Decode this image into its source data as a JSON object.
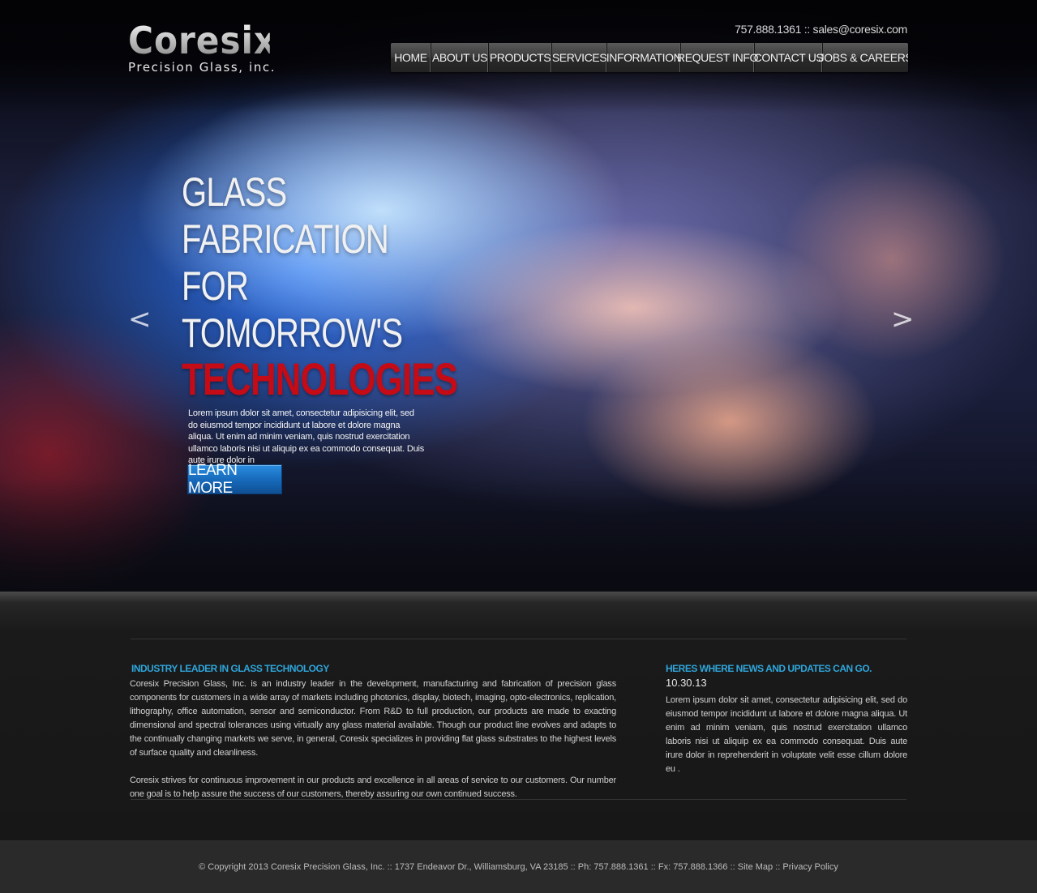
{
  "brand": {
    "name": "Coresix",
    "tagline": "Precision Glass, inc."
  },
  "contact": {
    "phone": "757.888.1361",
    "separator": "::",
    "email": "sales@coresix.com"
  },
  "nav": {
    "items": [
      {
        "label": "HOME"
      },
      {
        "label": "ABOUT US"
      },
      {
        "label": "PRODUCTS"
      },
      {
        "label": "SERVICES"
      },
      {
        "label": "INFORMATION"
      },
      {
        "label": "REQUEST INFO"
      },
      {
        "label": "CONTACT US"
      },
      {
        "label": "JOBS & CAREERS"
      }
    ]
  },
  "hero": {
    "prev_arrow": "<",
    "next_arrow": ">",
    "headline_lines": [
      "GLASS",
      "FABRICATION",
      "FOR",
      "TOMORROW'S"
    ],
    "headline_accent": "TECHNOLOGIES",
    "body": "Lorem ipsum dolor sit amet, consectetur adipisicing elit, sed do eiusmod tempor incididunt ut labore et dolore magna aliqua. Ut enim ad minim veniam, quis nostrud exercitation ullamco laboris nisi ut aliquip ex ea commodo consequat. Duis aute irure dolor in",
    "cta_label": "LEARN MORE"
  },
  "about": {
    "title": "INDUSTRY LEADER IN GLASS TECHNOLOGY",
    "paragraphs": [
      "Coresix Precision Glass, Inc. is an industry leader in the development, manufacturing and fabrication of precision glass components for customers in a wide array of markets including photonics, display, biotech, imaging, opto-electronics, replication, lithography, office automation, sensor and semiconductor. From R&D to full production, our products are made to exacting dimensional and spectral tolerances using virtually any glass material available. Though our product line evolves and adapts to the continually changing markets we serve, in general, Coresix specializes in providing flat glass substrates to the highest levels of surface quality and cleanliness.",
      "Coresix strives for continuous improvement in our products and excellence in all areas of service to our customers. Our number one goal is to help assure the success of our customers, thereby assuring our own continued success."
    ]
  },
  "news": {
    "title": "HERES WHERE NEWS AND UPDATES CAN GO.",
    "date": "10.30.13",
    "body": "Lorem ipsum dolor sit amet, consectetur adipisicing elit, sed do eiusmod tempor incididunt ut labore et dolore magna aliqua. Ut enim ad minim veniam, quis nostrud exercitation ullamco laboris nisi ut aliquip ex ea commodo consequat. Duis aute irure dolor in reprehenderit in voluptate velit esse cillum dolore eu ."
  },
  "footer": {
    "copyright": "© Copyright 2013 Coresix Precision Glass, Inc. :: 1737 Endeavor Dr., Williamsburg, VA 23185 :: Ph: 757.888.1361 :: Fx: 757.888.1366 ::",
    "sitemap_label": "Site Map",
    "separator": "::",
    "privacy_label": "Privacy Policy"
  }
}
